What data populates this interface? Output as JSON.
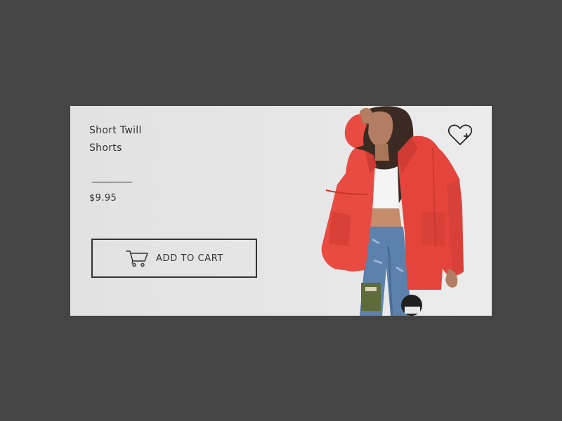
{
  "product": {
    "title_line1": "Short Twill",
    "title_line2": "Shorts",
    "price": "$9.95"
  },
  "cart_button": {
    "label": "ADD TO CART",
    "icon": "shopping-cart-icon"
  },
  "wishlist": {
    "icon": "heart-plus-icon"
  },
  "colors": {
    "page_background": "#454545",
    "card_background": "#e4e4e4",
    "text": "#333333",
    "jacket": "#e84b42",
    "jeans": "#5c81ac"
  }
}
